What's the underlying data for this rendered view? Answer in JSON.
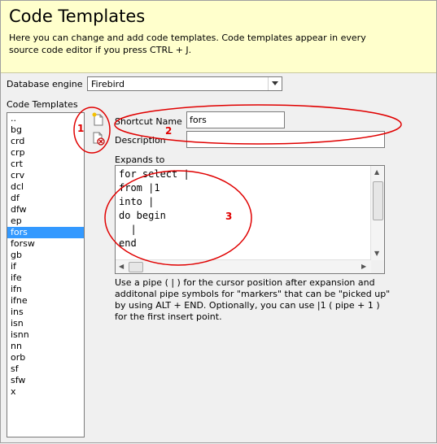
{
  "header": {
    "title": "Code Templates",
    "description": "Here you can change and add code templates. Code templates appear in every source code editor if you press CTRL + J."
  },
  "engine": {
    "label": "Database engine",
    "selected": "Firebird"
  },
  "templates": {
    "label": "Code Templates",
    "items": [
      "..",
      "bg",
      "crd",
      "crp",
      "crt",
      "crv",
      "dcl",
      "df",
      "dfw",
      "ep",
      "fors",
      "forsw",
      "gb",
      "if",
      "ife",
      "ifn",
      "ifne",
      "ins",
      "isn",
      "isnn",
      "nn",
      "orb",
      "sf",
      "sfw",
      "x"
    ],
    "selected": "fors"
  },
  "form": {
    "shortcut_label": "Shortcut Name",
    "shortcut_value": "fors",
    "description_label": "Description",
    "description_value": "",
    "expands_label": "Expands to",
    "code_lines": "for select |\nfrom |1\ninto |\ndo begin\n  |\nend",
    "hint": "Use a pipe ( | ) for the cursor position after expansion and additonal pipe symbols for \"markers\" that can be \"picked up\" by using ALT + END. Optionally, you can use |1 ( pipe + 1 ) for the first insert point."
  },
  "icons": {
    "new_template": "new-document-icon",
    "delete_template": "delete-document-icon"
  },
  "annotations": {
    "one": "1",
    "two": "2",
    "three": "3",
    "color": "#e00000"
  }
}
